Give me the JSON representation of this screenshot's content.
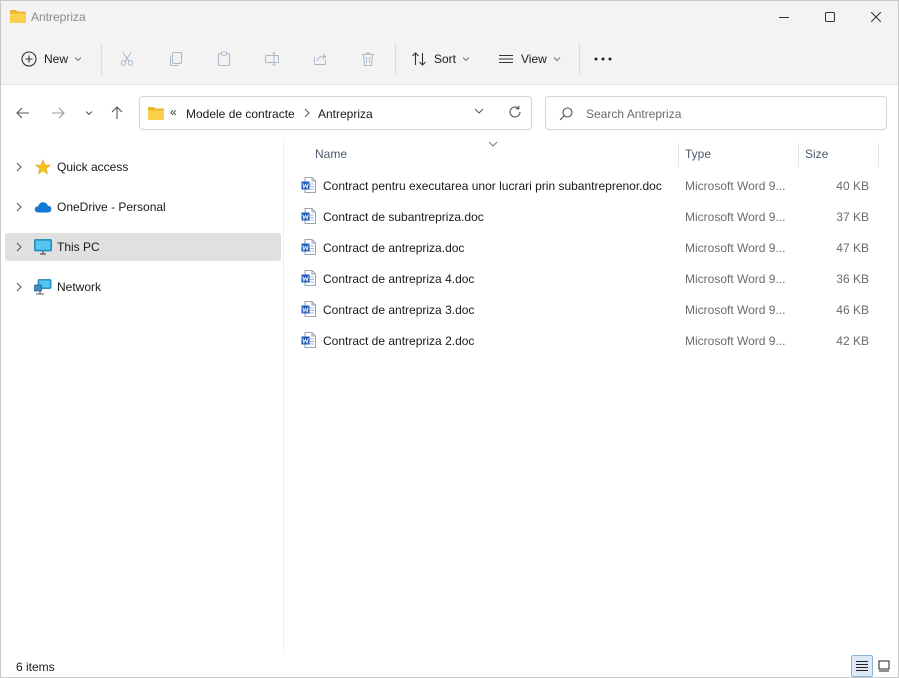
{
  "window": {
    "title": "Antrepriza",
    "minimize_icon": "minimize-icon",
    "maximize_icon": "maximize-icon",
    "close_icon": "close-icon"
  },
  "toolbar": {
    "new_label": "New",
    "sort_label": "Sort",
    "view_label": "View",
    "more_icon": "more-icon",
    "icons": [
      "cut-icon",
      "copy-icon",
      "paste-icon",
      "rename-icon",
      "share-icon",
      "delete-icon"
    ]
  },
  "address": {
    "overflow": "«",
    "crumbs": [
      "Modele de contracte",
      "Antrepriza"
    ]
  },
  "search": {
    "placeholder": "Search Antrepriza"
  },
  "sidebar": {
    "items": [
      {
        "label": "Quick access",
        "icon": "star-icon"
      },
      {
        "label": "OneDrive - Personal",
        "icon": "cloud-icon"
      },
      {
        "label": "This PC",
        "icon": "monitor-icon",
        "selected": true
      },
      {
        "label": "Network",
        "icon": "network-icon"
      }
    ]
  },
  "columns": {
    "name": "Name",
    "type": "Type",
    "size": "Size"
  },
  "files": [
    {
      "name": "Contract pentru executarea unor lucrari prin subantreprenor.doc",
      "type": "Microsoft Word 9...",
      "size": "40 KB"
    },
    {
      "name": "Contract de subantrepriza.doc",
      "type": "Microsoft Word 9...",
      "size": "37 KB"
    },
    {
      "name": "Contract de antrepriza.doc",
      "type": "Microsoft Word 9...",
      "size": "47 KB"
    },
    {
      "name": "Contract de antrepriza 4.doc",
      "type": "Microsoft Word 9...",
      "size": "36 KB"
    },
    {
      "name": "Contract de antrepriza 3.doc",
      "type": "Microsoft Word 9...",
      "size": "46 KB"
    },
    {
      "name": "Contract de antrepriza 2.doc",
      "type": "Microsoft Word 9...",
      "size": "42 KB"
    }
  ],
  "status": {
    "count": "6 items"
  },
  "colors": {
    "accent": "#0067c0",
    "folder": "#f4c542",
    "selected_bg": "#e0e0e0"
  }
}
